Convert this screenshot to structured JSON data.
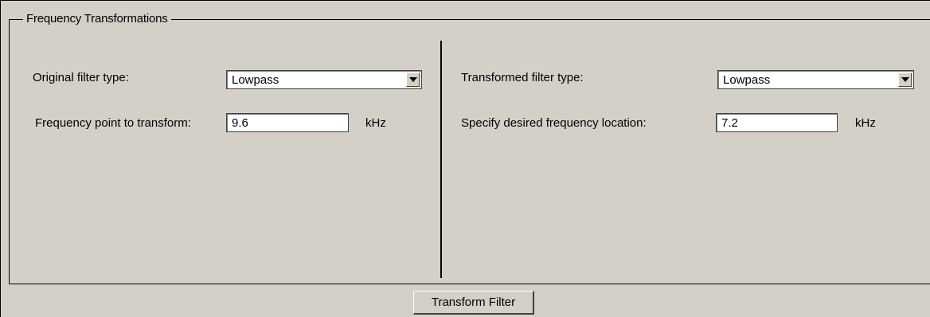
{
  "group": {
    "title": "Frequency Transformations"
  },
  "original": {
    "filter_type_label": "Original filter type:",
    "filter_type_value": "Lowpass",
    "freq_point_label": "Frequency point to transform:",
    "freq_point_value": "9.6",
    "freq_point_unit": "kHz"
  },
  "transformed": {
    "filter_type_label": "Transformed filter type:",
    "filter_type_value": "Lowpass",
    "freq_location_label": "Specify desired frequency location:",
    "freq_location_value": "7.2",
    "freq_location_unit": "kHz"
  },
  "actions": {
    "transform_label": "Transform Filter"
  }
}
